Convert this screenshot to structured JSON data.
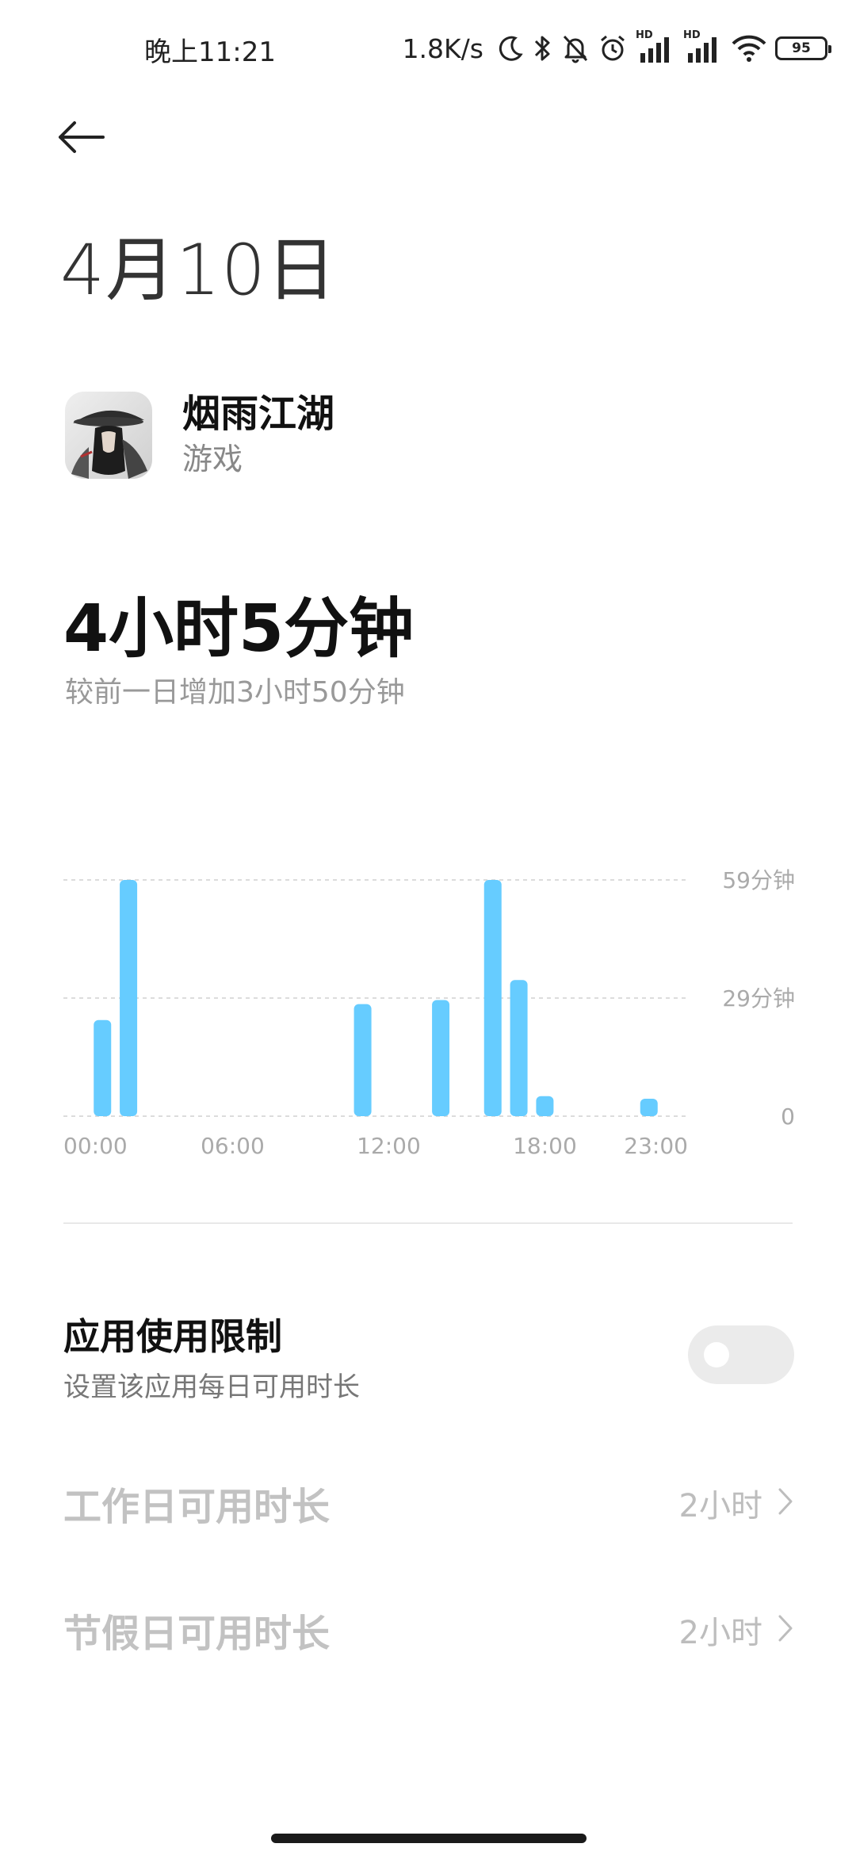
{
  "status_bar": {
    "time": "晚上11:21",
    "net_speed": "1.8K/s",
    "signal_badge": "HD",
    "battery": "95",
    "icons": [
      "moon-icon",
      "bluetooth-icon",
      "bell-off-icon",
      "alarm-icon",
      "signal-icon",
      "signal-icon",
      "wifi-icon",
      "battery-icon"
    ]
  },
  "header": {
    "back_icon": "arrow-left-icon",
    "title": "4月10日"
  },
  "app": {
    "name": "烟雨江湖",
    "category": "游戏"
  },
  "usage": {
    "total": "4小时5分钟",
    "comparison": "较前一日增加3小时50分钟"
  },
  "chart_data": {
    "type": "bar",
    "x_unit": "hour",
    "x_tick_labels": [
      "00:00",
      "06:00",
      "12:00",
      "18:00",
      "23:00"
    ],
    "y_tick_labels": [
      "59分钟",
      "29分钟",
      "0"
    ],
    "ylim": [
      0,
      59
    ],
    "grid": true,
    "color": "#66ccff",
    "series": [
      {
        "hours": [
          1,
          2,
          11,
          14,
          16,
          17,
          18,
          22
        ],
        "values": [
          24,
          59,
          28,
          29,
          59,
          34,
          5,
          2
        ]
      }
    ]
  },
  "limit": {
    "title": "应用使用限制",
    "subtitle": "设置该应用每日可用时长",
    "enabled": false
  },
  "settings": [
    {
      "label": "工作日可用时长",
      "value": "2小时"
    },
    {
      "label": "节假日可用时长",
      "value": "2小时"
    }
  ]
}
